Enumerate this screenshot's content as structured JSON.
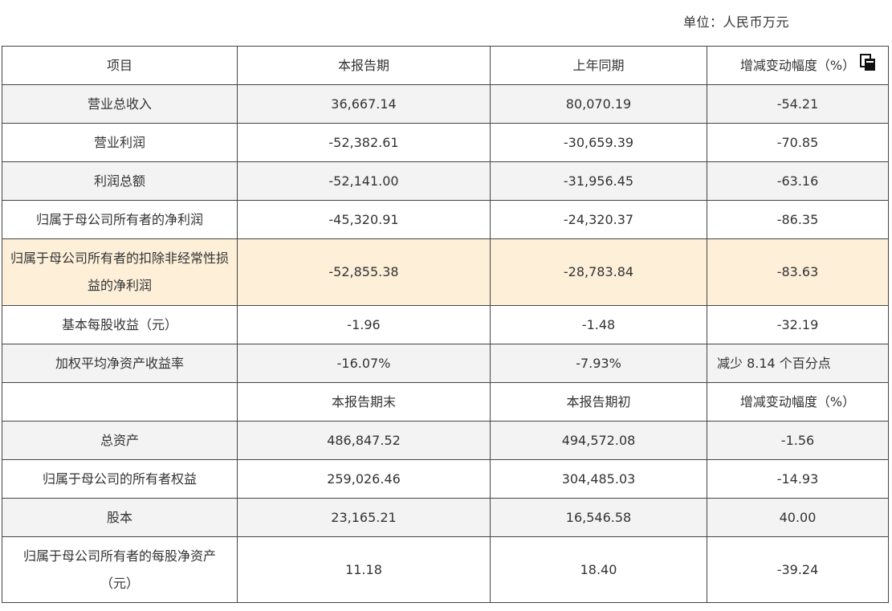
{
  "unit_label": "单位：人民币万元",
  "icons": {
    "copy": "copy-icon"
  },
  "header1": [
    "项目",
    "本报告期",
    "上年同期",
    "增减变动幅度（%）"
  ],
  "rows1": [
    [
      "营业总收入",
      "36,667.14",
      "80,070.19",
      "-54.21"
    ],
    [
      "营业利润",
      "-52,382.61",
      "-30,659.39",
      "-70.85"
    ],
    [
      "利润总额",
      "-52,141.00",
      "-31,956.45",
      "-63.16"
    ],
    [
      "归属于母公司所有者的净利润",
      "-45,320.91",
      "-24,320.37",
      "-86.35"
    ],
    [
      "归属于母公司所有者的扣除非经常性损益的净利润",
      "-52,855.38",
      "-28,783.84",
      "-83.63"
    ],
    [
      "基本每股收益（元）",
      "-1.96",
      "-1.48",
      "-32.19"
    ],
    [
      "加权平均净资产收益率",
      "-16.07%",
      "-7.93%",
      "减少 8.14 个百分点"
    ]
  ],
  "header2": [
    "",
    "本报告期末",
    "本报告期初",
    "增减变动幅度（%）"
  ],
  "rows2": [
    [
      "总资产",
      "486,847.52",
      "494,572.08",
      "-1.56"
    ],
    [
      "归属于母公司的所有者权益",
      "259,026.46",
      "304,485.03",
      "-14.93"
    ],
    [
      "股本",
      "23,165.21",
      "16,546.58",
      "40.00"
    ],
    [
      "归属于母公司所有者的每股净资产（元）",
      "11.18",
      "18.40",
      "-39.24"
    ]
  ]
}
